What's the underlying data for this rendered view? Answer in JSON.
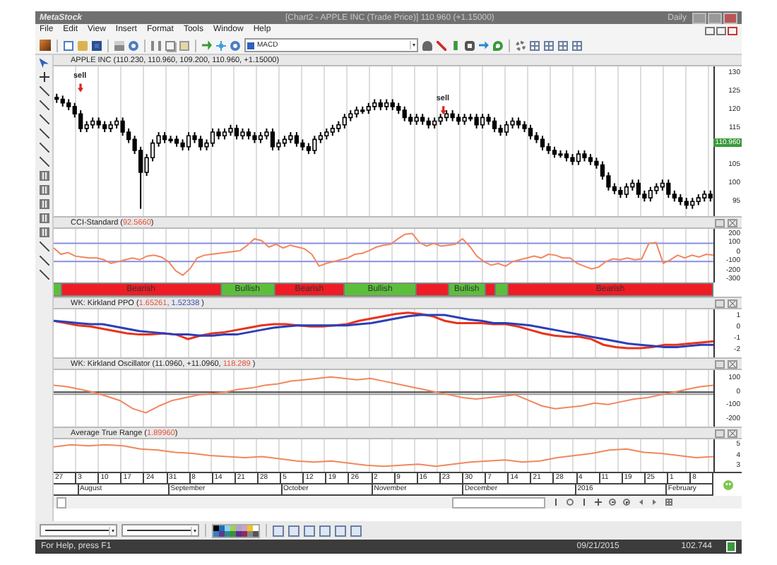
{
  "title_bar": {
    "app_name": "MetaStock",
    "document": "[Chart2 - APPLE INC (Trade Price)]  110.960 (+1.15000)",
    "periodicity": "Daily"
  },
  "menu": [
    "File",
    "Edit",
    "View",
    "Insert",
    "Format",
    "Tools",
    "Window",
    "Help"
  ],
  "toolbar": {
    "indicator_select": "MACD"
  },
  "chart": {
    "header": "APPLE INC (110.230, 110.960, 109.200, 110.960, +1.15000)",
    "last_price": "110.960",
    "annotations": [
      "sell",
      "sell"
    ],
    "chart_data": {
      "type": "candlestick",
      "ylim": [
        91,
        132
      ],
      "yticks": [
        130,
        125,
        120,
        115,
        105,
        100,
        95
      ],
      "ohlc": [
        [
          123.5,
          124.5,
          122,
          123
        ],
        [
          123,
          124,
          121,
          122
        ],
        [
          122,
          123,
          120,
          121
        ],
        [
          121,
          122,
          118,
          119
        ],
        [
          119,
          120,
          114,
          115
        ],
        [
          115,
          117,
          114,
          116
        ],
        [
          116,
          118,
          115,
          117
        ],
        [
          117,
          118,
          115,
          116
        ],
        [
          116,
          117,
          114,
          115
        ],
        [
          115,
          117,
          114,
          116
        ],
        [
          116,
          118,
          115,
          117
        ],
        [
          117,
          118,
          113,
          114
        ],
        [
          114,
          115,
          111,
          112
        ],
        [
          112,
          113,
          108,
          109
        ],
        [
          109,
          110,
          93,
          103
        ],
        [
          103,
          108,
          102,
          107
        ],
        [
          107,
          112,
          106,
          111
        ],
        [
          111,
          114,
          110,
          113
        ],
        [
          113,
          114,
          111,
          112
        ],
        [
          112,
          113,
          111,
          112
        ],
        [
          112,
          113,
          110,
          111
        ],
        [
          111,
          112,
          109,
          110
        ],
        [
          110,
          114,
          109,
          113
        ],
        [
          113,
          114,
          111,
          112
        ],
        [
          112,
          113,
          109,
          110
        ],
        [
          110,
          112,
          109,
          111
        ],
        [
          111,
          115,
          110,
          114
        ],
        [
          114,
          115,
          112,
          113
        ],
        [
          113,
          115,
          112,
          114
        ],
        [
          114,
          116,
          113,
          115
        ],
        [
          115,
          116,
          112,
          113
        ],
        [
          113,
          115,
          112,
          114
        ],
        [
          114,
          115,
          112,
          113
        ],
        [
          113,
          114,
          111,
          112
        ],
        [
          112,
          114,
          111,
          113
        ],
        [
          113,
          115,
          112,
          114
        ],
        [
          114,
          115,
          109,
          110
        ],
        [
          110,
          112,
          109,
          111
        ],
        [
          111,
          113,
          110,
          112
        ],
        [
          112,
          114,
          111,
          113
        ],
        [
          113,
          114,
          110,
          111
        ],
        [
          111,
          112,
          109,
          110
        ],
        [
          110,
          111,
          108,
          109
        ],
        [
          109,
          113,
          108,
          112
        ],
        [
          112,
          114,
          111,
          113
        ],
        [
          113,
          115,
          112,
          114
        ],
        [
          114,
          116,
          113,
          115
        ],
        [
          115,
          117,
          114,
          116
        ],
        [
          116,
          119,
          115,
          118
        ],
        [
          118,
          120,
          117,
          119
        ],
        [
          119,
          121,
          118,
          120
        ],
        [
          120,
          121,
          119,
          120
        ],
        [
          120,
          122,
          119,
          121
        ],
        [
          121,
          123,
          120,
          122
        ],
        [
          122,
          123,
          120,
          121
        ],
        [
          121,
          123,
          120,
          122
        ],
        [
          122,
          123,
          120,
          121
        ],
        [
          121,
          122,
          119,
          120
        ],
        [
          120,
          121,
          117,
          118
        ],
        [
          118,
          119,
          116,
          117
        ],
        [
          117,
          119,
          116,
          118
        ],
        [
          118,
          119,
          116,
          117
        ],
        [
          117,
          118,
          115,
          116
        ],
        [
          116,
          118,
          115,
          117
        ],
        [
          117,
          119,
          116,
          118
        ],
        [
          118,
          120,
          117,
          119
        ],
        [
          119,
          120,
          117,
          118
        ],
        [
          118,
          119,
          116,
          117
        ],
        [
          117,
          119,
          116,
          118
        ],
        [
          118,
          119,
          117,
          118
        ],
        [
          118,
          119,
          115,
          116
        ],
        [
          116,
          119,
          115,
          118
        ],
        [
          118,
          119,
          116,
          117
        ],
        [
          117,
          118,
          114,
          115
        ],
        [
          115,
          116,
          113,
          114
        ],
        [
          114,
          117,
          113,
          116
        ],
        [
          116,
          118,
          115,
          117
        ],
        [
          117,
          118,
          115,
          116
        ],
        [
          116,
          117,
          114,
          115
        ],
        [
          115,
          116,
          112,
          113
        ],
        [
          113,
          114,
          111,
          112
        ],
        [
          112,
          113,
          109,
          110
        ],
        [
          110,
          111,
          108,
          109
        ],
        [
          109,
          110,
          107,
          108
        ],
        [
          108,
          109,
          107,
          108
        ],
        [
          108,
          109,
          106,
          107
        ],
        [
          107,
          108,
          105,
          106
        ],
        [
          106,
          109,
          105,
          108
        ],
        [
          108,
          109,
          106,
          107
        ],
        [
          107,
          108,
          105,
          106
        ],
        [
          106,
          107,
          104,
          105
        ],
        [
          105,
          106,
          101,
          102
        ],
        [
          102,
          103,
          98,
          99
        ],
        [
          99,
          100,
          97,
          98
        ],
        [
          98,
          99,
          96,
          97
        ],
        [
          97,
          100,
          96,
          99
        ],
        [
          99,
          101,
          98,
          100
        ],
        [
          100,
          101,
          96,
          97
        ],
        [
          97,
          98,
          95,
          96
        ],
        [
          96,
          99,
          95,
          98
        ],
        [
          98,
          100,
          97,
          99
        ],
        [
          99,
          101,
          98,
          100
        ],
        [
          100,
          101,
          96,
          97
        ],
        [
          97,
          98,
          95,
          96
        ],
        [
          96,
          97,
          94,
          95
        ],
        [
          95,
          96,
          93,
          94
        ],
        [
          94,
          96,
          93,
          95
        ],
        [
          95,
          97,
          94,
          96
        ],
        [
          96,
          98,
          95,
          97
        ],
        [
          97,
          98,
          95,
          96
        ]
      ]
    }
  },
  "panels": [
    {
      "kind": "cci",
      "header": [
        {
          "text": "CCI-Standard ("
        },
        {
          "text": "92.5660",
          "color": "#e8503a"
        },
        {
          "text": ")"
        }
      ],
      "chart_data": {
        "type": "line",
        "ylim": [
          -330,
          260
        ],
        "yticks": [
          200,
          100,
          0,
          -100,
          -200,
          -300
        ],
        "series": [
          {
            "color": "#f2865e",
            "values": [
              50,
              -20,
              0,
              -40,
              -50,
              -60,
              -60,
              -80,
              -120,
              -100,
              -80,
              -60,
              -80,
              -40,
              -30,
              -50,
              -100,
              -200,
              -250,
              -180,
              -60,
              -30,
              -20,
              -10,
              0,
              10,
              20,
              80,
              150,
              130,
              60,
              90,
              50,
              80,
              60,
              40,
              -20,
              -150,
              -120,
              -100,
              -80,
              -60,
              -20,
              -10,
              20,
              60,
              80,
              90,
              150,
              200,
              210,
              110,
              70,
              100,
              70,
              80,
              90,
              150,
              70,
              -40,
              -100,
              -140,
              -120,
              -150,
              -100,
              -80,
              -60,
              -40,
              -60,
              -20,
              -30,
              -60,
              -60,
              -120,
              -150,
              -180,
              -160,
              -100,
              -70,
              -80,
              -60,
              -80,
              -70,
              100,
              110,
              -120,
              -80,
              -30,
              -60,
              -30,
              -50,
              -20,
              -30
            ]
          }
        ]
      },
      "signal_bar": [
        {
          "kind": "bullish"
        },
        {
          "kind": "bearish",
          "label": "Bearish"
        },
        {
          "kind": "bullish",
          "label": "Bullish"
        },
        {
          "kind": "bearish",
          "label": "Bearish"
        },
        {
          "kind": "bullish",
          "label": "Bullish"
        },
        {
          "kind": "bearish"
        },
        {
          "kind": "bullish",
          "label": "Bullish"
        },
        {
          "kind": "bearish"
        },
        {
          "kind": "bullish"
        },
        {
          "kind": "bearish",
          "label": "Bearish"
        }
      ]
    },
    {
      "kind": "ppo",
      "header": [
        {
          "text": "WK: Kirkland PPO ("
        },
        {
          "text": "1.65261",
          "color": "#e8503a"
        },
        {
          "text": ", 1.52338",
          "color": "#3a4fb0"
        },
        {
          "text": " )"
        }
      ],
      "chart_data": {
        "type": "line",
        "ylim": [
          -2.6,
          1.6
        ],
        "yticks": [
          1,
          0,
          -1,
          -2
        ],
        "series": [
          {
            "color": "#e8331c",
            "values": [
              0.6,
              0.4,
              0.2,
              0.1,
              -0.1,
              -0.3,
              -0.5,
              -0.6,
              -0.6,
              -0.5,
              -0.6,
              -1.0,
              -0.7,
              -0.5,
              -0.4,
              -0.2,
              0.0,
              0.2,
              0.3,
              0.3,
              0.2,
              0.1,
              0.1,
              0.2,
              0.3,
              0.6,
              0.8,
              1.0,
              1.2,
              1.3,
              1.2,
              1.0,
              0.6,
              0.4,
              0.4,
              0.4,
              0.3,
              0.3,
              0.1,
              -0.2,
              -0.5,
              -0.7,
              -0.8,
              -0.8,
              -1.0,
              -1.5,
              -1.7,
              -1.8,
              -1.8,
              -1.7,
              -1.5,
              -1.5,
              -1.4,
              -1.3,
              -1.2
            ]
          },
          {
            "color": "#2b3fb8",
            "values": [
              0.6,
              0.5,
              0.4,
              0.3,
              0.3,
              0.1,
              -0.1,
              -0.3,
              -0.4,
              -0.5,
              -0.6,
              -0.6,
              -0.7,
              -0.7,
              -0.6,
              -0.6,
              -0.4,
              -0.2,
              0.0,
              0.1,
              0.2,
              0.2,
              0.2,
              0.2,
              0.2,
              0.3,
              0.4,
              0.6,
              0.8,
              1.0,
              1.1,
              1.1,
              1.1,
              0.9,
              0.7,
              0.6,
              0.4,
              0.4,
              0.3,
              0.2,
              0.0,
              -0.2,
              -0.4,
              -0.6,
              -0.8,
              -1.0,
              -1.2,
              -1.4,
              -1.5,
              -1.6,
              -1.7,
              -1.7,
              -1.6,
              -1.5,
              -1.5
            ]
          }
        ]
      }
    },
    {
      "kind": "oscillator",
      "header": [
        {
          "text": "WK: Kirkland Oscillator (11.0960, +11.0960, "
        },
        {
          "text": "118.289",
          "color": "#e8503a"
        },
        {
          "text": " )"
        }
      ],
      "chart_data": {
        "type": "line",
        "ylim": [
          -250,
          160
        ],
        "yticks": [
          100,
          0,
          -100,
          -200
        ],
        "series": [
          {
            "color": "#f2865e",
            "values": [
              50,
              40,
              20,
              0,
              -30,
              -60,
              -120,
              -150,
              -100,
              -60,
              -40,
              -20,
              -10,
              0,
              20,
              30,
              50,
              60,
              80,
              90,
              100,
              110,
              100,
              90,
              100,
              80,
              60,
              40,
              20,
              0,
              -20,
              -40,
              -50,
              -40,
              -30,
              -20,
              -60,
              -100,
              -120,
              -110,
              -100,
              -80,
              -90,
              -70,
              -50,
              -40,
              -20,
              0,
              20,
              40,
              50
            ]
          }
        ]
      }
    },
    {
      "kind": "atr",
      "header": [
        {
          "text": "Average True Range ("
        },
        {
          "text": "1.89960",
          "color": "#e8503a"
        },
        {
          "text": ")"
        }
      ],
      "chart_data": {
        "type": "line",
        "ylim": [
          2.5,
          5.5
        ],
        "yticks": [
          5,
          4,
          3
        ],
        "series": [
          {
            "color": "#f2865e",
            "values": [
              4.8,
              5.0,
              4.9,
              5.0,
              4.9,
              4.6,
              4.5,
              4.3,
              4.2,
              4.0,
              3.9,
              3.8,
              3.9,
              3.7,
              3.5,
              3.4,
              3.5,
              3.3,
              3.1,
              3.0,
              3.1,
              3.2,
              3.0,
              3.2,
              3.4,
              3.5,
              3.6,
              3.4,
              3.5,
              3.8,
              4.0,
              4.2,
              4.5,
              4.6,
              4.3,
              4.2,
              4.0,
              3.8,
              3.9
            ]
          }
        ]
      }
    }
  ],
  "date_axis": {
    "leading_days": [
      "27"
    ],
    "months": [
      {
        "label": "August",
        "days": [
          "3",
          "10",
          "17",
          "24"
        ]
      },
      {
        "label": "September",
        "days": [
          "31",
          "8",
          "14",
          "21",
          "28"
        ]
      },
      {
        "label": "October",
        "days": [
          "5",
          "12",
          "19",
          "26"
        ]
      },
      {
        "label": "November",
        "days": [
          "2",
          "9",
          "16",
          "23"
        ]
      },
      {
        "label": "December",
        "days": [
          "30",
          "7",
          "14",
          "21",
          "28"
        ]
      },
      {
        "label": "2016",
        "days": [
          "4",
          "11",
          "19",
          "25"
        ]
      },
      {
        "label": "February",
        "days": [
          "1",
          "8"
        ]
      }
    ]
  },
  "status_bar": {
    "help": "For Help, press F1",
    "date": "09/21/2015",
    "value": "102.744"
  }
}
